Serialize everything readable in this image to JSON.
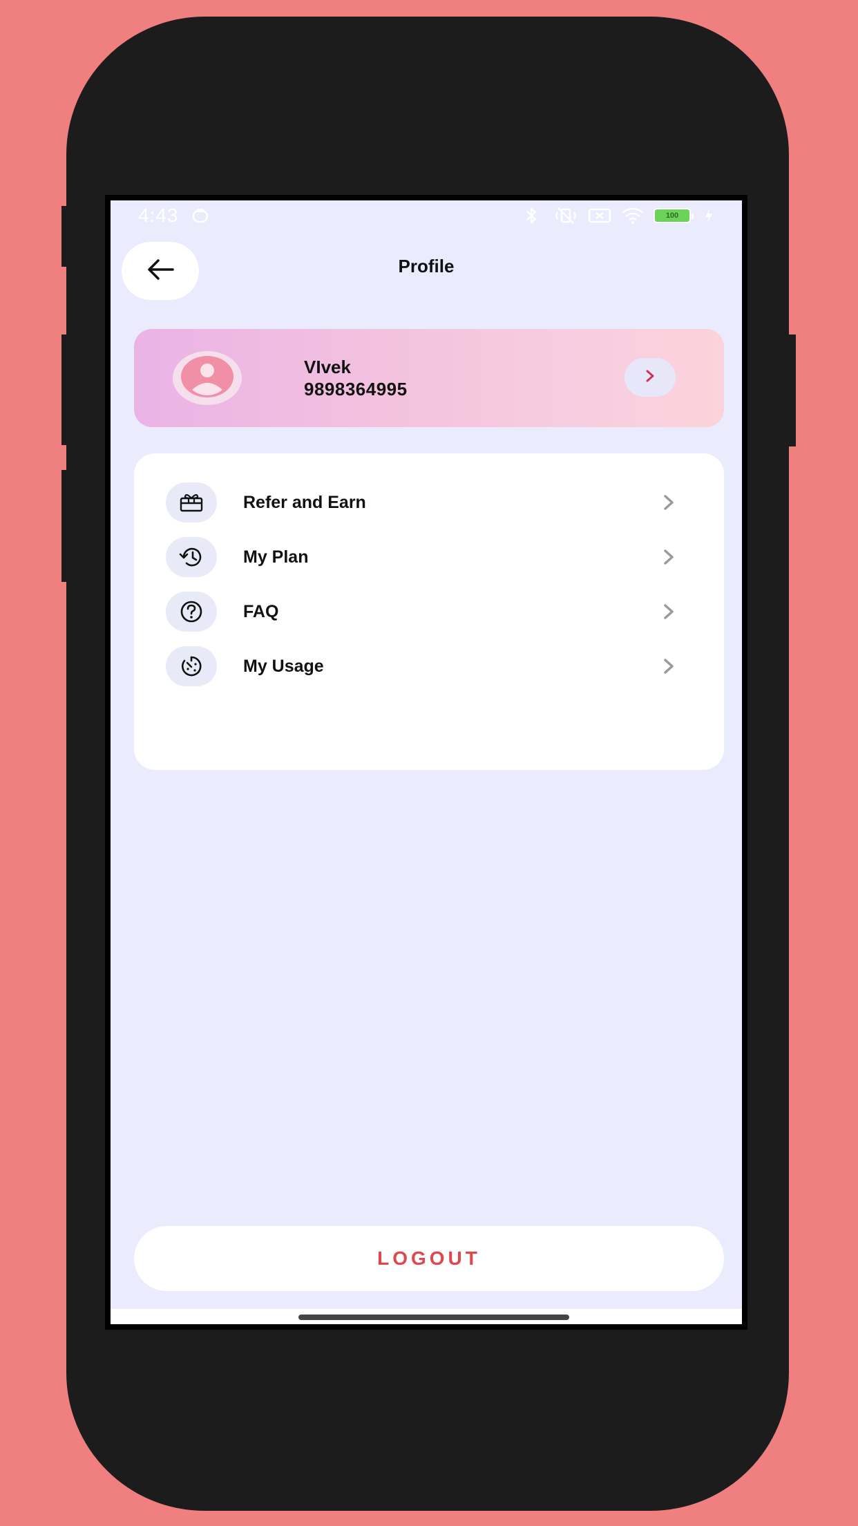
{
  "status_bar": {
    "time": "4:43",
    "battery_text": "100"
  },
  "header": {
    "title": "Profile"
  },
  "profile": {
    "name": "VIvek",
    "phone": "9898364995"
  },
  "menu": {
    "items": [
      {
        "label": "Refer and Earn",
        "icon": "gift-icon"
      },
      {
        "label": "My Plan",
        "icon": "history-icon"
      },
      {
        "label": "FAQ",
        "icon": "question-icon"
      },
      {
        "label": "My Usage",
        "icon": "usage-gauge-icon"
      }
    ]
  },
  "logout": {
    "label": "LOGOUT"
  },
  "colors": {
    "background": "#F08080",
    "screen": "#EAEBFD",
    "logout_text": "#E0474C",
    "accent_arrow": "#D0305A"
  }
}
